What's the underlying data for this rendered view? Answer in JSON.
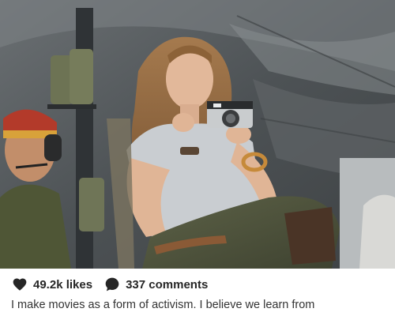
{
  "post": {
    "image_alt": "Woman holding a vintage rangefinder camera inside a military helicopter, crew member with headset in the background",
    "likes_label": "49.2k likes",
    "comments_label": "337 comments",
    "caption": "I make movies as a form of activism. I believe we learn from"
  },
  "icons": {
    "like": "heart-icon",
    "comment": "comment-bubble-icon"
  },
  "colors": {
    "text": "#262626",
    "icon": "#262626",
    "background": "#ffffff"
  }
}
